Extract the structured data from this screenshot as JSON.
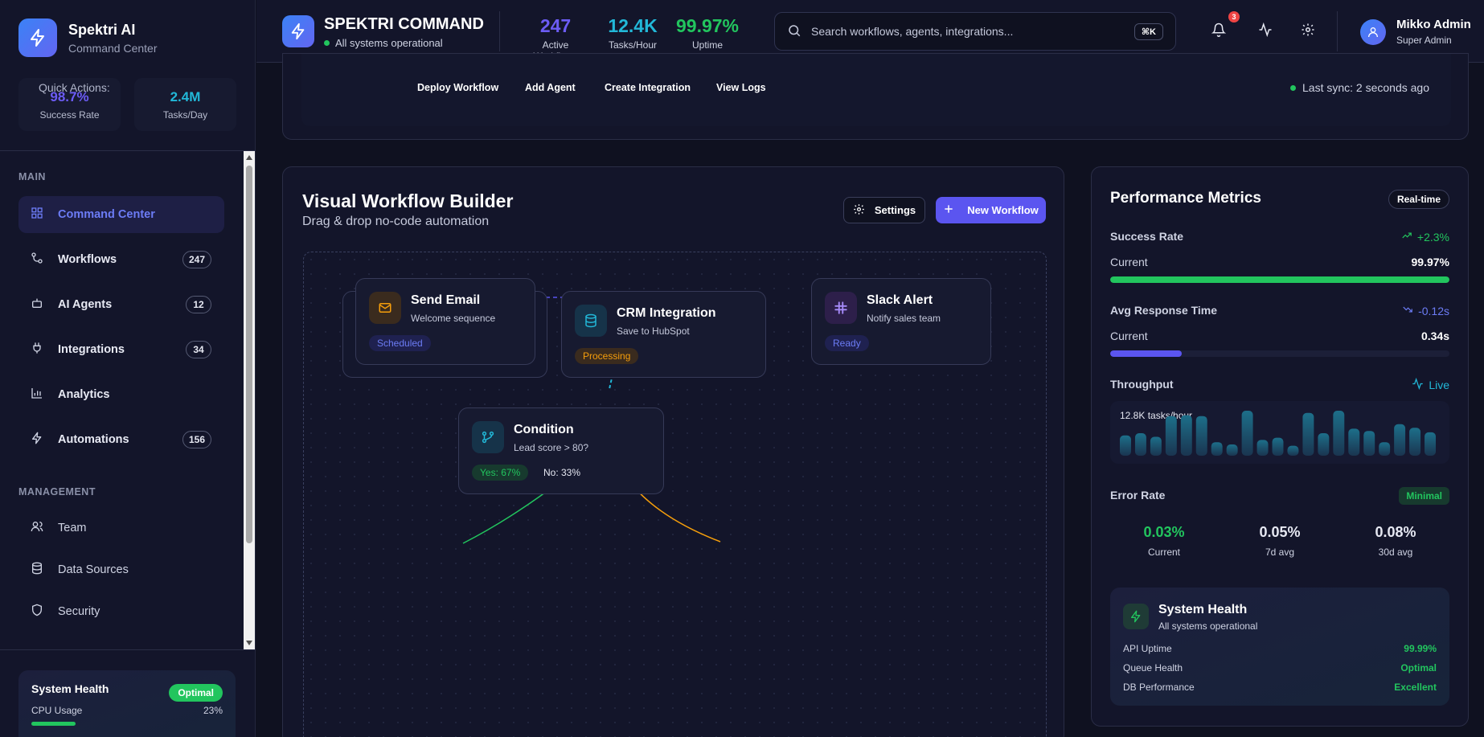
{
  "brand": {
    "name": "Spektri AI",
    "subtitle": "Command Center"
  },
  "sidebar_stats": [
    {
      "value": "98.7%",
      "label": "Success Rate",
      "color": "#6c5cf5"
    },
    {
      "value": "2.4M",
      "label": "Tasks/Day",
      "color": "#22b8d8"
    }
  ],
  "nav": {
    "main_title": "MAIN",
    "main_items": [
      {
        "label": "Command Center",
        "icon": "grid-icon",
        "count": null
      },
      {
        "label": "Workflows",
        "icon": "workflow-icon",
        "count": "247"
      },
      {
        "label": "AI Agents",
        "icon": "bot-icon",
        "count": "12"
      },
      {
        "label": "Integrations",
        "icon": "plug-icon",
        "count": "34"
      },
      {
        "label": "Analytics",
        "icon": "bar-chart-icon",
        "count": null
      },
      {
        "label": "Automations",
        "icon": "bolt-icon",
        "count": "156"
      }
    ],
    "management_title": "MANAGEMENT",
    "management_items": [
      {
        "label": "Team",
        "icon": "users-icon"
      },
      {
        "label": "Data Sources",
        "icon": "database-icon"
      },
      {
        "label": "Security",
        "icon": "shield-icon"
      }
    ]
  },
  "sidebar_health": {
    "title": "System Health",
    "badge": "Optimal",
    "cpu_label": "CPU Usage",
    "cpu_value": "23%",
    "cpu_fraction": 0.23
  },
  "header": {
    "title": "SPEKTRI COMMAND",
    "status": "All systems operational",
    "kpis": [
      {
        "value": "247",
        "label": "Active Workflows",
        "color": "#6c5cf5"
      },
      {
        "value": "12.4K",
        "label": "Tasks/Hour",
        "color": "#22b8d8"
      },
      {
        "value": "99.97%",
        "label": "Uptime",
        "color": "#22c55e"
      }
    ],
    "search_placeholder": "Search workflows, agents, integrations...",
    "search_shortcut": "⌘K",
    "notification_count": "3",
    "user": {
      "name": "Mikko Admin",
      "role": "Super Admin"
    }
  },
  "quick_actions": {
    "label": "Quick Actions:",
    "buttons": [
      "Deploy Workflow",
      "Add Agent",
      "Create Integration",
      "View Logs"
    ],
    "sync": "Last sync: 2 seconds ago"
  },
  "builder": {
    "title": "Visual Workflow Builder",
    "subtitle": "Drag & drop no-code automation",
    "settings_label": "Settings",
    "new_label": "New Workflow",
    "nodes": [
      {
        "title": "Send Email",
        "sub": "Welcome sequence",
        "status": "Scheduled",
        "icon": "mail-icon"
      },
      {
        "title": "CRM Integration",
        "sub": "Save to HubSpot",
        "status": "Processing",
        "icon": "database-icon"
      },
      {
        "title": "Slack Alert",
        "sub": "Notify sales team",
        "status": "Ready",
        "icon": "slack-icon"
      },
      {
        "title": "Condition",
        "sub": "Lead score > 80?",
        "yes": "Yes: 67%",
        "no": "No: 33%",
        "icon": "branch-icon"
      }
    ]
  },
  "performance": {
    "title": "Performance Metrics",
    "badge": "Real-time",
    "success": {
      "label": "Success Rate",
      "delta": "+2.3%",
      "current_label": "Current",
      "current": "99.97%",
      "fraction": 0.9997
    },
    "response": {
      "label": "Avg Response Time",
      "delta": "-0.12s",
      "current_label": "Current",
      "current": "0.34s",
      "fraction": 0.21
    },
    "throughput": {
      "label": "Throughput",
      "live": "Live",
      "caption": "12.8K tasks/hour",
      "bars": [
        0.45,
        0.5,
        0.42,
        0.88,
        0.9,
        0.88,
        0.3,
        0.25,
        1.0,
        0.35,
        0.4,
        0.22,
        0.95,
        0.5,
        1.0,
        0.6,
        0.55,
        0.3,
        0.7,
        0.62,
        0.52
      ]
    },
    "error": {
      "label": "Error Rate",
      "badge": "Minimal",
      "cells": [
        {
          "value": "0.03%",
          "label": "Current",
          "color": "#22c55e"
        },
        {
          "value": "0.05%",
          "label": "7d avg",
          "color": "#e6e8f2"
        },
        {
          "value": "0.08%",
          "label": "30d avg",
          "color": "#e6e8f2"
        }
      ]
    },
    "system_health": {
      "title": "System Health",
      "subtitle": "All systems operational",
      "rows": [
        {
          "label": "API Uptime",
          "value": "99.99%"
        },
        {
          "label": "Queue Health",
          "value": "Optimal"
        },
        {
          "label": "DB Performance",
          "value": "Excellent"
        }
      ]
    }
  }
}
